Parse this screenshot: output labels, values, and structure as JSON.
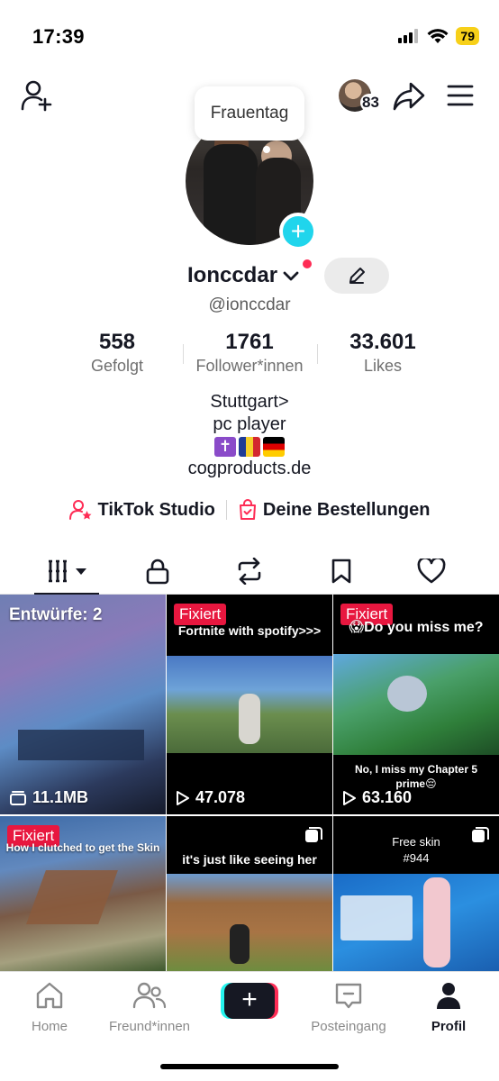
{
  "status_bar": {
    "time": "17:39",
    "battery": "79"
  },
  "topbar": {
    "avatar_count": "83"
  },
  "profile": {
    "tooltip": "Frauentag",
    "username": "Ionccdar",
    "handle": "@ionccdar"
  },
  "stats": [
    {
      "value": "558",
      "label": "Gefolgt"
    },
    {
      "value": "1761",
      "label": "Follower*innen"
    },
    {
      "value": "33.601",
      "label": "Likes"
    }
  ],
  "bio": {
    "line1": "Stuttgart>",
    "line2": "pc player",
    "link": "cogproducts.de"
  },
  "links": {
    "studio": "TikTok Studio",
    "orders": "Deine Bestellungen"
  },
  "grid": {
    "drafts": "Entwürfe: 2",
    "draft_size": "11.1MB",
    "pinned_label": "Fixiert",
    "v2_caption": "Fortnite with spotify>>>",
    "v2_views": "47.078",
    "v3_caption": "😱Do you miss me?",
    "v3_subcaption": "No, I miss my Chapter 5 prime😔",
    "v3_views": "63.160",
    "v4_caption": "How I clutched to get the Skin",
    "v5_caption": "it's just like seeing her",
    "v6_caption_1": "Free skin",
    "v6_caption_2": "#944"
  },
  "nav": {
    "home": "Home",
    "friends": "Freund*innen",
    "create": "+",
    "inbox": "Posteingang",
    "profile": "Profil"
  },
  "colors": {
    "accent_red": "#fe2c55",
    "accent_cyan": "#25f4ee",
    "pin_red": "#e8173f",
    "battery_yellow": "#f7d019"
  }
}
